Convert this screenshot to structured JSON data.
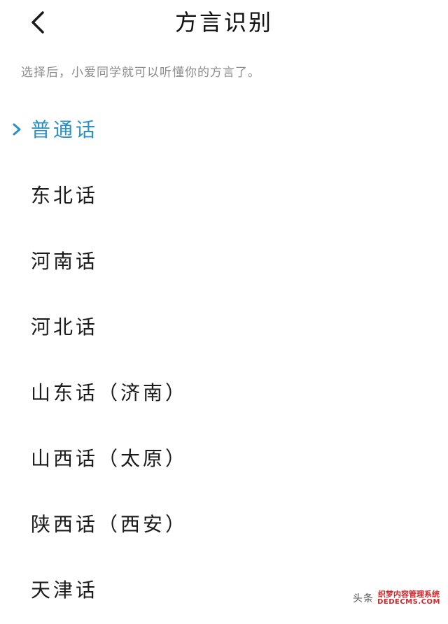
{
  "header": {
    "title": "方言识别",
    "back_icon": "chevron-left-icon"
  },
  "subtitle": "选择后，小爱同学就可以听懂你的方言了。",
  "accent_color": "#2a8fc4",
  "dialects": [
    {
      "label": "普通话",
      "selected": true
    },
    {
      "label": "东北话",
      "selected": false
    },
    {
      "label": "河南话",
      "selected": false
    },
    {
      "label": "河北话",
      "selected": false
    },
    {
      "label": "山东话（济南）",
      "selected": false
    },
    {
      "label": "山西话（太原）",
      "selected": false
    },
    {
      "label": "陕西话（西安）",
      "selected": false
    },
    {
      "label": "天津话",
      "selected": false
    }
  ],
  "watermark": {
    "brand": "头条",
    "site_cn": "织梦内容管理系统",
    "site_en": "DEDECMS.COM"
  }
}
